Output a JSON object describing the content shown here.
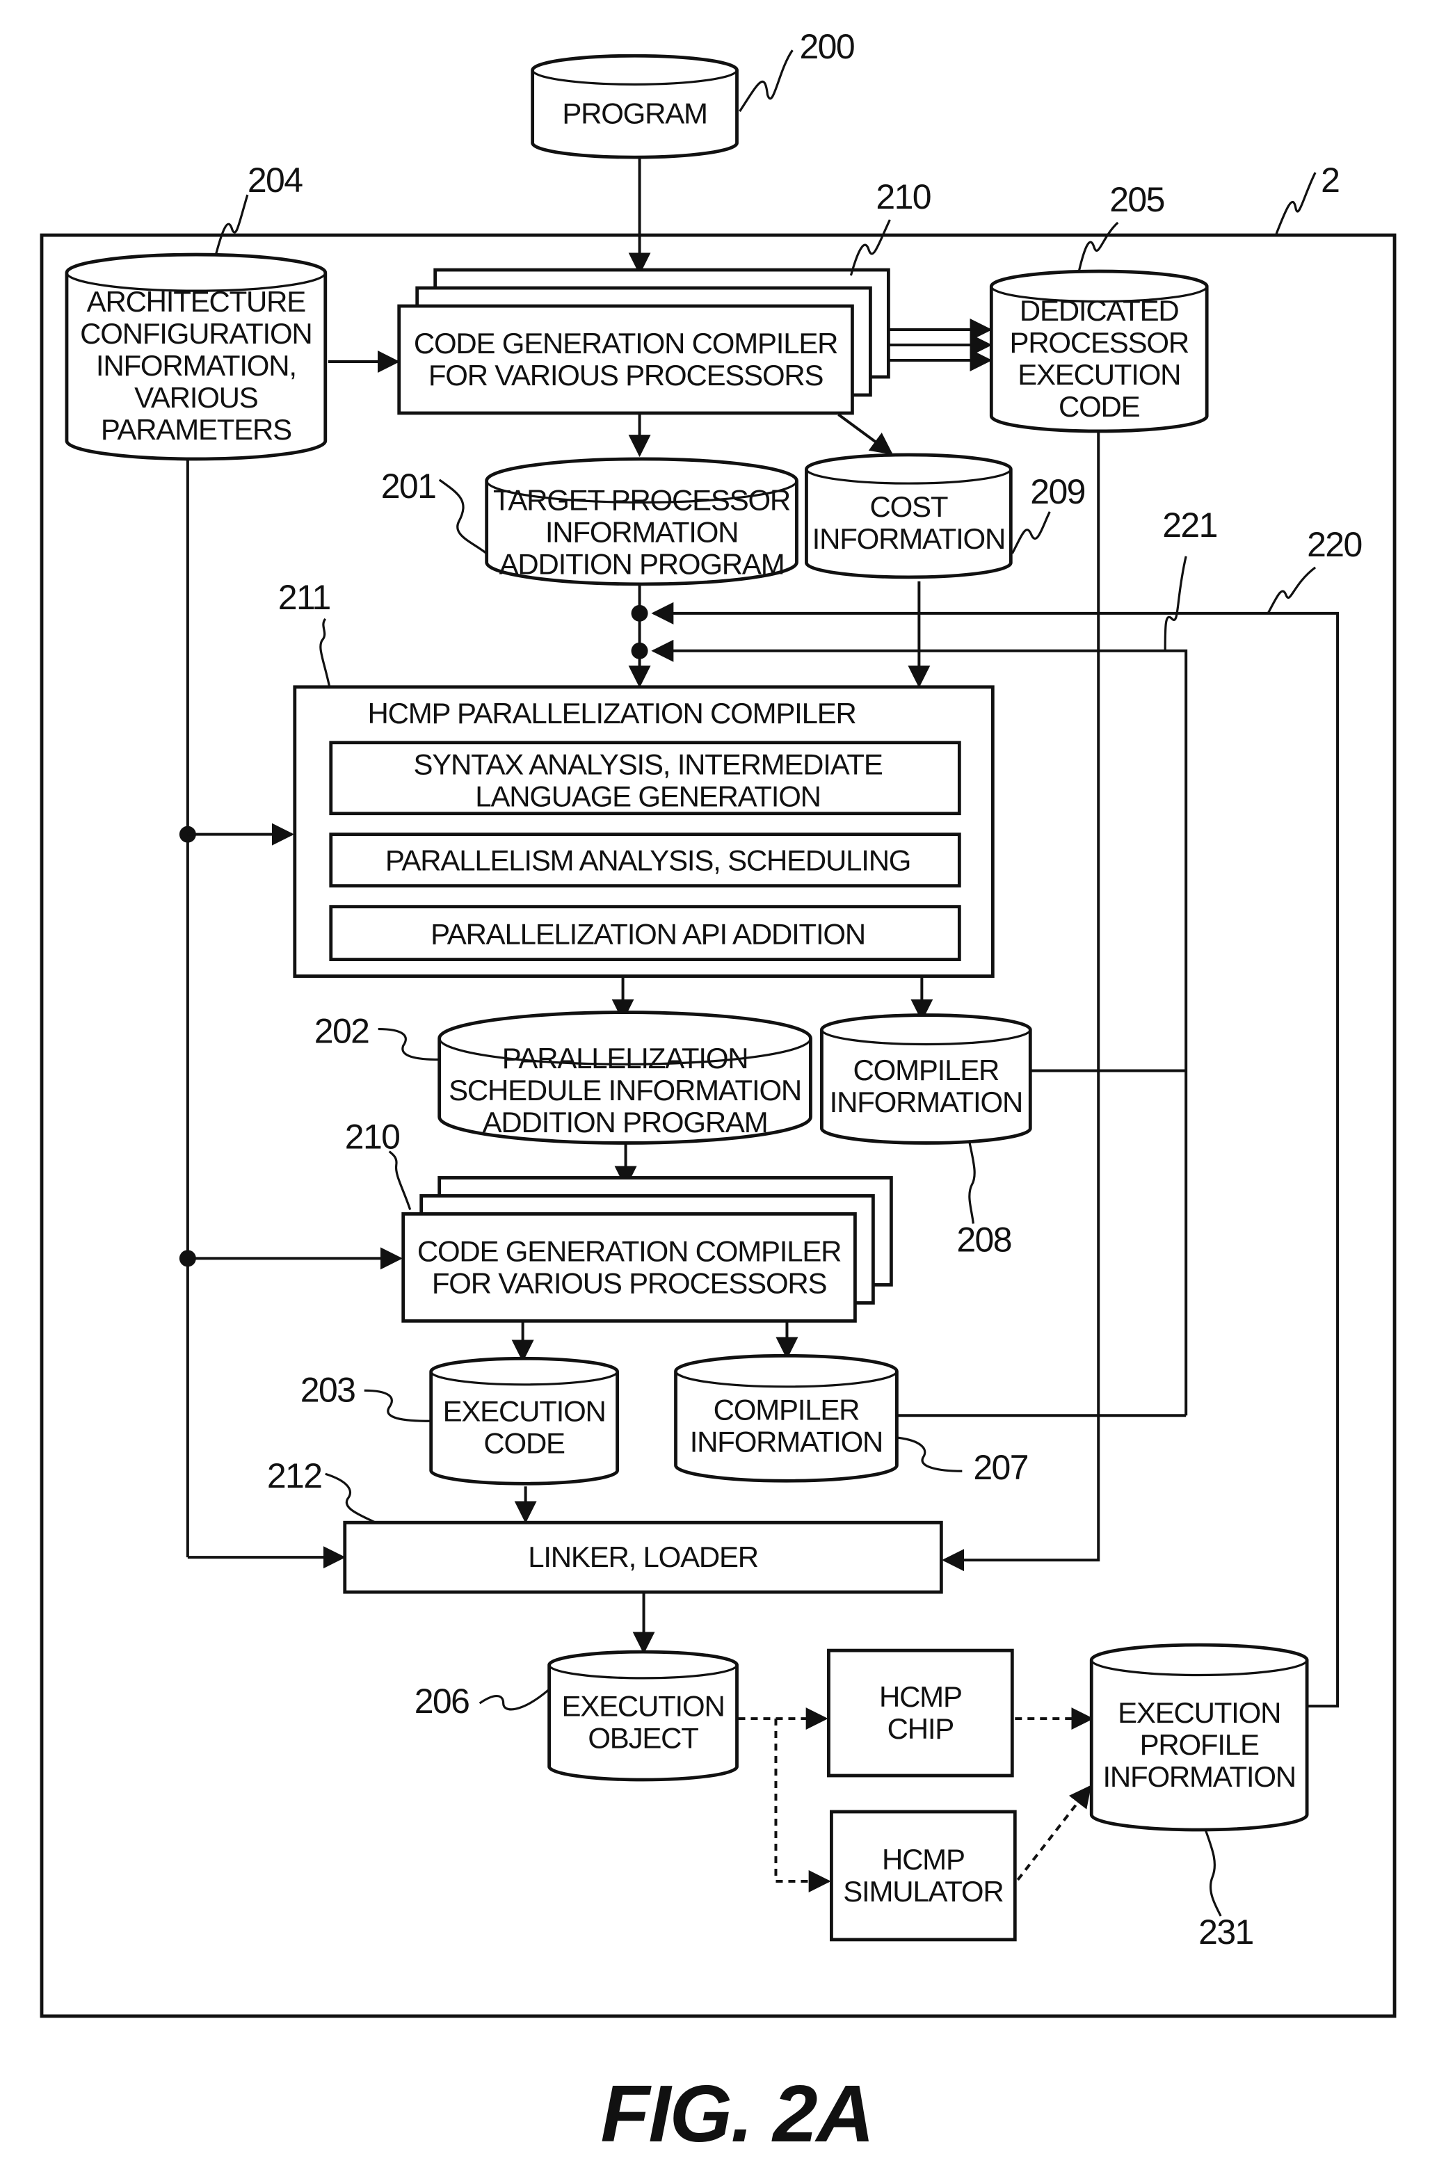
{
  "figure": {
    "caption": "FIG. 2A",
    "system_ref": "2"
  },
  "nodes": {
    "program": {
      "ref": "200",
      "lines": [
        "PROGRAM"
      ]
    },
    "arch_config": {
      "ref": "204",
      "lines": [
        "ARCHITECTURE",
        "CONFIGURATION",
        "INFORMATION,",
        "VARIOUS",
        "PARAMETERS"
      ]
    },
    "code_gen_top": {
      "ref": "210",
      "lines": [
        "CODE GENERATION COMPILER",
        "FOR VARIOUS PROCESSORS"
      ]
    },
    "dedicated_code": {
      "ref": "205",
      "lines": [
        "DEDICATED",
        "PROCESSOR",
        "EXECUTION",
        "CODE"
      ]
    },
    "target_info_prog": {
      "ref": "201",
      "lines": [
        "TARGET PROCESSOR",
        "INFORMATION",
        "ADDITION PROGRAM"
      ]
    },
    "cost_info": {
      "ref": "209",
      "lines": [
        "COST",
        "INFORMATION"
      ]
    },
    "hcmp_compiler": {
      "ref": "211",
      "title": "HCMP PARALLELIZATION COMPILER",
      "stages": [
        [
          "SYNTAX ANALYSIS, INTERMEDIATE",
          "LANGUAGE GENERATION"
        ],
        [
          "PARALLELISM ANALYSIS, SCHEDULING"
        ],
        [
          "PARALLELIZATION API ADDITION"
        ]
      ]
    },
    "sched_info_prog": {
      "ref": "202",
      "lines": [
        "PARALLELIZATION",
        "SCHEDULE INFORMATION",
        "ADDITION PROGRAM"
      ]
    },
    "compiler_info_208": {
      "ref": "208",
      "lines": [
        "COMPILER",
        "INFORMATION"
      ]
    },
    "code_gen_bottom": {
      "ref": "210",
      "lines": [
        "CODE GENERATION COMPILER",
        "FOR VARIOUS PROCESSORS"
      ]
    },
    "exec_code": {
      "ref": "203",
      "lines": [
        "EXECUTION",
        "CODE"
      ]
    },
    "compiler_info_207": {
      "ref": "207",
      "lines": [
        "COMPILER",
        "INFORMATION"
      ]
    },
    "linker": {
      "ref": "212",
      "lines": [
        "LINKER, LOADER"
      ]
    },
    "exec_object": {
      "ref": "206",
      "lines": [
        "EXECUTION",
        "OBJECT"
      ]
    },
    "hcmp_chip": {
      "lines": [
        "HCMP",
        "CHIP"
      ]
    },
    "hcmp_sim": {
      "lines": [
        "HCMP",
        "SIMULATOR"
      ]
    },
    "exec_profile": {
      "ref": "231",
      "lines": [
        "EXECUTION",
        "PROFILE",
        "INFORMATION"
      ]
    }
  },
  "feedback_refs": {
    "profile_feedback": "220",
    "compiler_feedback": "221"
  }
}
